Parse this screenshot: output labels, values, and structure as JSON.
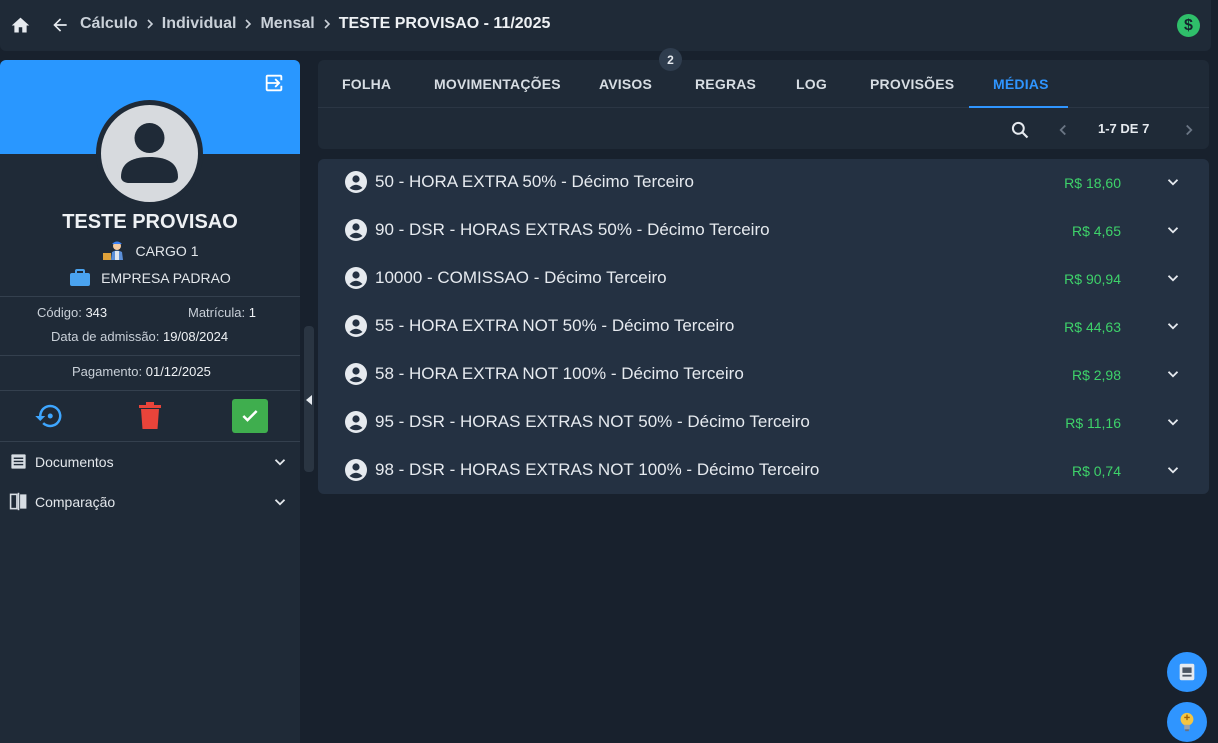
{
  "header": {
    "breadcrumbs": [
      "Cálculo",
      "Individual",
      "Mensal",
      "TESTE PROVISAO - 11/2025"
    ],
    "icons": {
      "home": "home-icon",
      "back": "arrow-left-icon",
      "status": "money-icon"
    },
    "status_symbol": "$"
  },
  "employee": {
    "name": "TESTE PROVISAO",
    "cargo": "CARGO 1",
    "empresa": "EMPRESA PADRAO",
    "codigo_label": "Código:",
    "codigo": "343",
    "matricula_label": "Matrícula:",
    "matricula": "1",
    "admissao_label": "Data de admissão:",
    "admissao": "19/08/2024",
    "pagamento_label": "Pagamento:",
    "pagamento": "01/12/2025"
  },
  "sidebar_menu": [
    {
      "label": "Documentos",
      "icon": "document-icon"
    },
    {
      "label": "Comparação",
      "icon": "compare-icon"
    }
  ],
  "tabs": [
    {
      "label": "FOLHA"
    },
    {
      "label": "MOVIMENTAÇÕES"
    },
    {
      "label": "AVISOS",
      "badge": "2"
    },
    {
      "label": "REGRAS"
    },
    {
      "label": "LOG"
    },
    {
      "label": "PROVISÕES"
    },
    {
      "label": "MÉDIAS",
      "active": true
    }
  ],
  "pager": {
    "text": "1-7 DE 7"
  },
  "items": [
    {
      "label": "50 - HORA EXTRA 50% - Décimo Terceiro",
      "value": "R$ 18,60"
    },
    {
      "label": "90 - DSR - HORAS EXTRAS 50% - Décimo Terceiro",
      "value": "R$ 4,65"
    },
    {
      "label": "10000 - COMISSAO - Décimo Terceiro",
      "value": "R$ 90,94"
    },
    {
      "label": "55 - HORA EXTRA NOT 50% - Décimo Terceiro",
      "value": "R$ 44,63"
    },
    {
      "label": "58 - HORA EXTRA NOT 100% - Décimo Terceiro",
      "value": "R$ 2,98"
    },
    {
      "label": "95 - DSR - HORAS EXTRAS NOT 50% - Décimo Terceiro",
      "value": "R$ 11,16"
    },
    {
      "label": "98 - DSR - HORAS EXTRAS NOT 100% - Décimo Terceiro",
      "value": "R$ 0,74"
    }
  ],
  "colors": {
    "accent": "#2f95ff",
    "positive": "#3ed26a",
    "danger": "#e8443a",
    "confirm": "#3fae4e"
  }
}
